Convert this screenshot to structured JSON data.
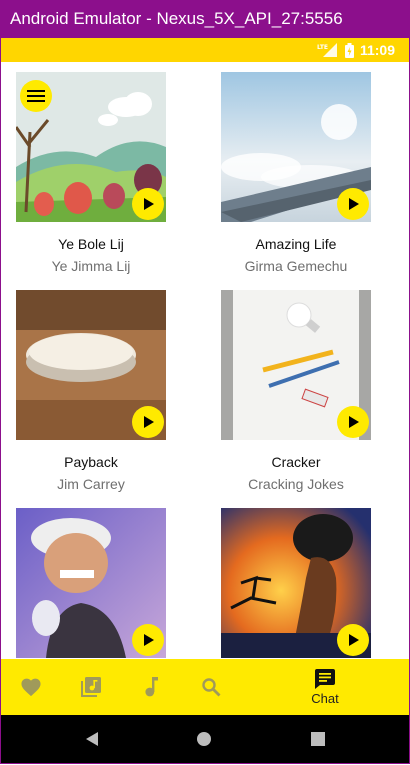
{
  "window": {
    "title": "Android Emulator - Nexus_5X_API_27:5556"
  },
  "status_bar": {
    "time": "11:09",
    "network": "LTE"
  },
  "cards": [
    {
      "title": "Ye Bole Lij",
      "subtitle": "Ye Jimma Lij"
    },
    {
      "title": "Amazing Life",
      "subtitle": "Girma Gemechu"
    },
    {
      "title": "Payback",
      "subtitle": "Jim Carrey"
    },
    {
      "title": "Cracker",
      "subtitle": "Cracking Jokes"
    },
    {
      "title": "",
      "subtitle": ""
    },
    {
      "title": "",
      "subtitle": ""
    }
  ],
  "bottom_nav": {
    "items": [
      {
        "icon": "heart-icon",
        "label": ""
      },
      {
        "icon": "library-music-icon",
        "label": ""
      },
      {
        "icon": "music-note-icon",
        "label": ""
      },
      {
        "icon": "search-icon",
        "label": ""
      },
      {
        "icon": "chat-icon",
        "label": "Chat"
      }
    ],
    "active_index": 4
  },
  "colors": {
    "accent": "#ffea00",
    "titlebar": "#8c0f8c",
    "statusbar": "#ffd600"
  }
}
